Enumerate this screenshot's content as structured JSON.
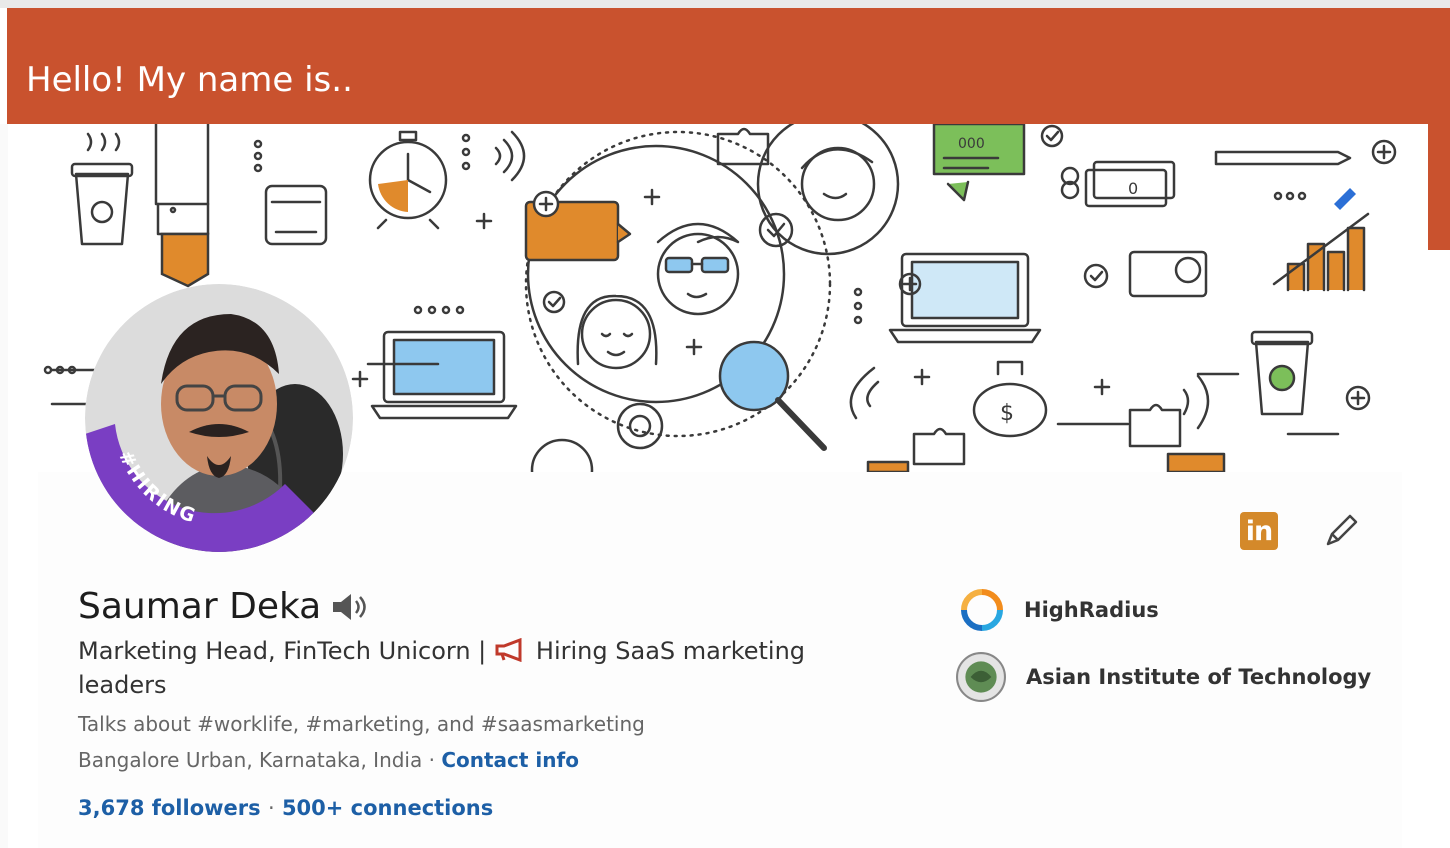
{
  "slide": {
    "title": "Hello! My name is..",
    "header_color": "#c9522e"
  },
  "profile": {
    "name": "Saumar Deka",
    "headline_part1": "Marketing Head, FinTech Unicorn |",
    "headline_part2": "Hiring SaaS marketing leaders",
    "talks_about": "Talks about #worklife, #marketing, and #saasmarketing",
    "location": "Bangalore Urban, Karnataka, India",
    "separator": "·",
    "contact_info": "Contact info",
    "followers": "3,678 followers",
    "connections": "500+ connections",
    "photo_frame_text": "#HIRING",
    "link_color": "#1d5fa6"
  },
  "actions": {
    "linkedin_icon": "linkedin-icon",
    "linkedin_label": "in",
    "edit_icon": "pencil-icon"
  },
  "organizations": [
    {
      "name": "HighRadius",
      "icon": "highradius-logo"
    },
    {
      "name": "Asian Institute of Technology",
      "icon": "ait-logo"
    }
  ],
  "banner": {
    "illustration": "fintech-doodle-banner",
    "bubble_text": "000",
    "cash_text": "0",
    "dollar_text": "$"
  }
}
